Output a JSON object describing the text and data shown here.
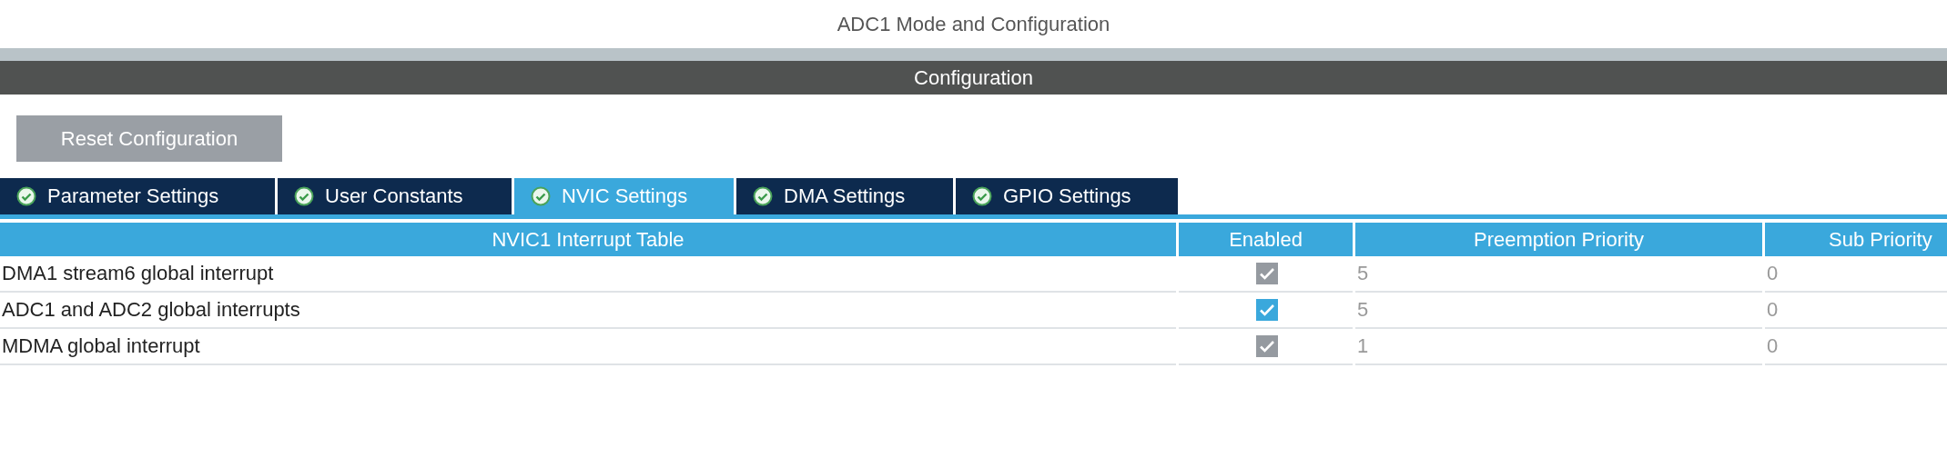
{
  "window": {
    "title": "ADC1 Mode and Configuration"
  },
  "section": {
    "title": "Configuration"
  },
  "reset_button": {
    "label": "Reset Configuration"
  },
  "tabs": [
    {
      "label": "Parameter Settings",
      "selected": false,
      "checked": true
    },
    {
      "label": "User Constants",
      "selected": false,
      "checked": true
    },
    {
      "label": "NVIC Settings",
      "selected": true,
      "checked": true
    },
    {
      "label": "DMA Settings",
      "selected": false,
      "checked": true
    },
    {
      "label": "GPIO Settings",
      "selected": false,
      "checked": true
    }
  ],
  "table": {
    "columns": [
      "NVIC1 Interrupt Table",
      "Enabled",
      "Preemption Priority",
      "Sub Priority"
    ],
    "rows": [
      {
        "name": "DMA1 stream6 global interrupt",
        "enabled": true,
        "disabled": true,
        "preemption": "5",
        "sub": "0"
      },
      {
        "name": "ADC1 and ADC2 global interrupts",
        "enabled": true,
        "disabled": false,
        "preemption": "5",
        "sub": "0"
      },
      {
        "name": "MDMA global interrupt",
        "enabled": true,
        "disabled": true,
        "preemption": "1",
        "sub": "0"
      }
    ]
  }
}
